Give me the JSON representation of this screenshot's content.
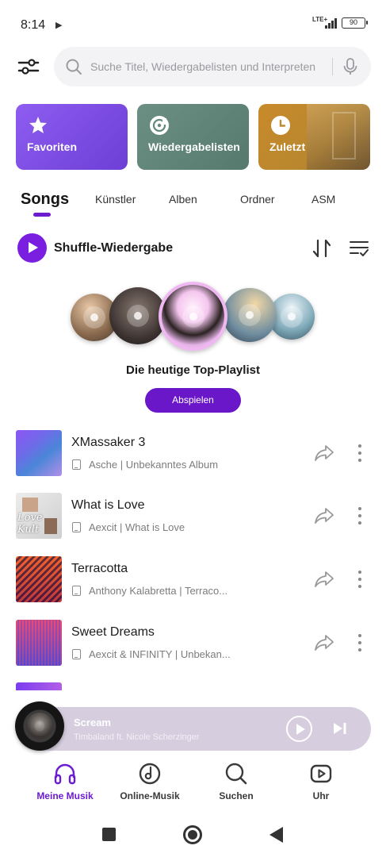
{
  "status_bar": {
    "time": "8:14",
    "network": "LTE+",
    "battery": "90"
  },
  "search": {
    "placeholder": "Suche Titel, Wiedergabelisten und Interpreten"
  },
  "shortcuts": [
    {
      "label": "Favoriten",
      "icon": "star-icon",
      "color": "#7b4be0"
    },
    {
      "label": "Wiedergabelisten",
      "icon": "playlist-disc-icon",
      "color": "#628a7c"
    },
    {
      "label": "Zuletzt",
      "icon": "clock-icon",
      "color": "#c08a31"
    }
  ],
  "tabs": [
    {
      "label": "Songs",
      "active": true
    },
    {
      "label": "Künstler",
      "active": false
    },
    {
      "label": "Alben",
      "active": false
    },
    {
      "label": "Ordner",
      "active": false
    },
    {
      "label": "ASM",
      "active": false
    }
  ],
  "shuffle": {
    "label": "Shuffle-Wiedergabe"
  },
  "top_playlist": {
    "title": "Die heutige Top-Playlist",
    "button": "Abspielen"
  },
  "songs": [
    {
      "title": "XMassaker 3",
      "subtitle": "Asche | Unbekanntes Album"
    },
    {
      "title": "What is Love",
      "subtitle": "Aexcit | What is Love",
      "art_text": "Love Kult"
    },
    {
      "title": "Terracotta",
      "subtitle": "Anthony Kalabretta | Terraco..."
    },
    {
      "title": "Sweet Dreams",
      "subtitle": "Aexcit & INFINITY | Unbekan..."
    }
  ],
  "now_playing": {
    "title": "Scream",
    "artist": "Timbaland ft. Nicole Scherzinger"
  },
  "bottom_nav": [
    {
      "label": "Meine Musik",
      "icon": "headphones-icon",
      "active": true
    },
    {
      "label": "Online-Musik",
      "icon": "music-disc-icon",
      "active": false
    },
    {
      "label": "Suchen",
      "icon": "search-icon",
      "active": false
    },
    {
      "label": "Uhr",
      "icon": "video-play-icon",
      "active": false
    }
  ],
  "colors": {
    "accent": "#6c1bd1",
    "mini_player_bg": "#d6cede"
  }
}
